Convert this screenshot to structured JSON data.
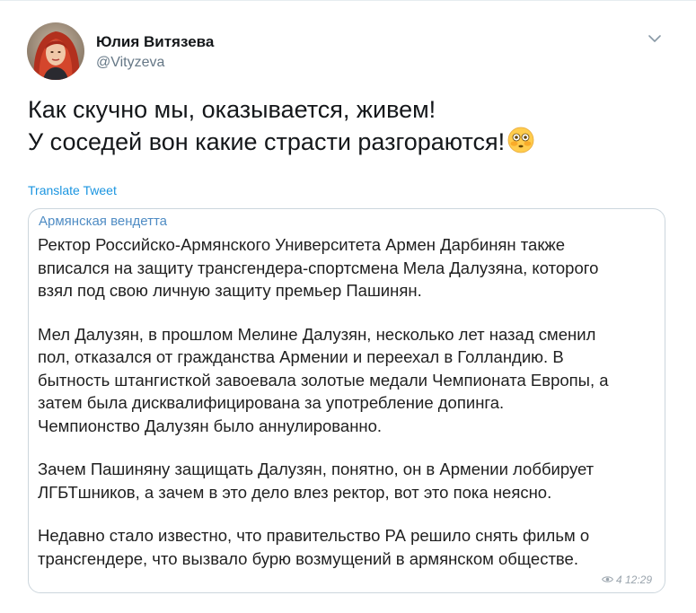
{
  "author": {
    "name": "Юлия Витязева",
    "handle": "@Vityzeva",
    "avatar_icon": "profile-photo"
  },
  "menu": {
    "caret_icon": "chevron-down-icon"
  },
  "tweet": {
    "lines": [
      "Как скучно мы, оказывается, живем!",
      "У соседей вон какие страсти разгораются!"
    ],
    "emoji": "flushed-face-emoji"
  },
  "translate_label": "Translate Tweet",
  "quote": {
    "title": "Армянская вендетта",
    "paragraphs": [
      [
        "Ректор Российско-Армянского Университета Армен Дарбинян также",
        "вписался на защиту трансгендера-спортсмена Мела Далузяна, которого",
        "взял под свою личную защиту премьер Пашинян."
      ],
      [
        "Мел Далузян, в прошлом Мелине Далузян, несколько лет назад сменил",
        "пол, отказался от гражданства Армении и переехал в Голландию. В",
        "бытность штангисткой завоевала золотые медали Чемпионата Европы, а",
        "затем была дисквалифицирована за употребление допинга.",
        "Чемпионство Далузян было аннулированно."
      ],
      [
        "Зачем Пашиняну защищать Далузян, понятно, он в Армении лоббирует",
        "ЛГБТшников, а зачем в это дело влез ректор, вот это пока неясно."
      ],
      [
        "Недавно стало известно, что правительство РА решило снять фильм о",
        "трансгендере, что вызвало бурю возмущений в армянском обществе."
      ]
    ],
    "views": "4",
    "time": "12:29"
  },
  "colors": {
    "link": "#1b95e0",
    "quote_title": "#4f8cc4",
    "muted": "#657786",
    "border": "#ccd6dd"
  }
}
